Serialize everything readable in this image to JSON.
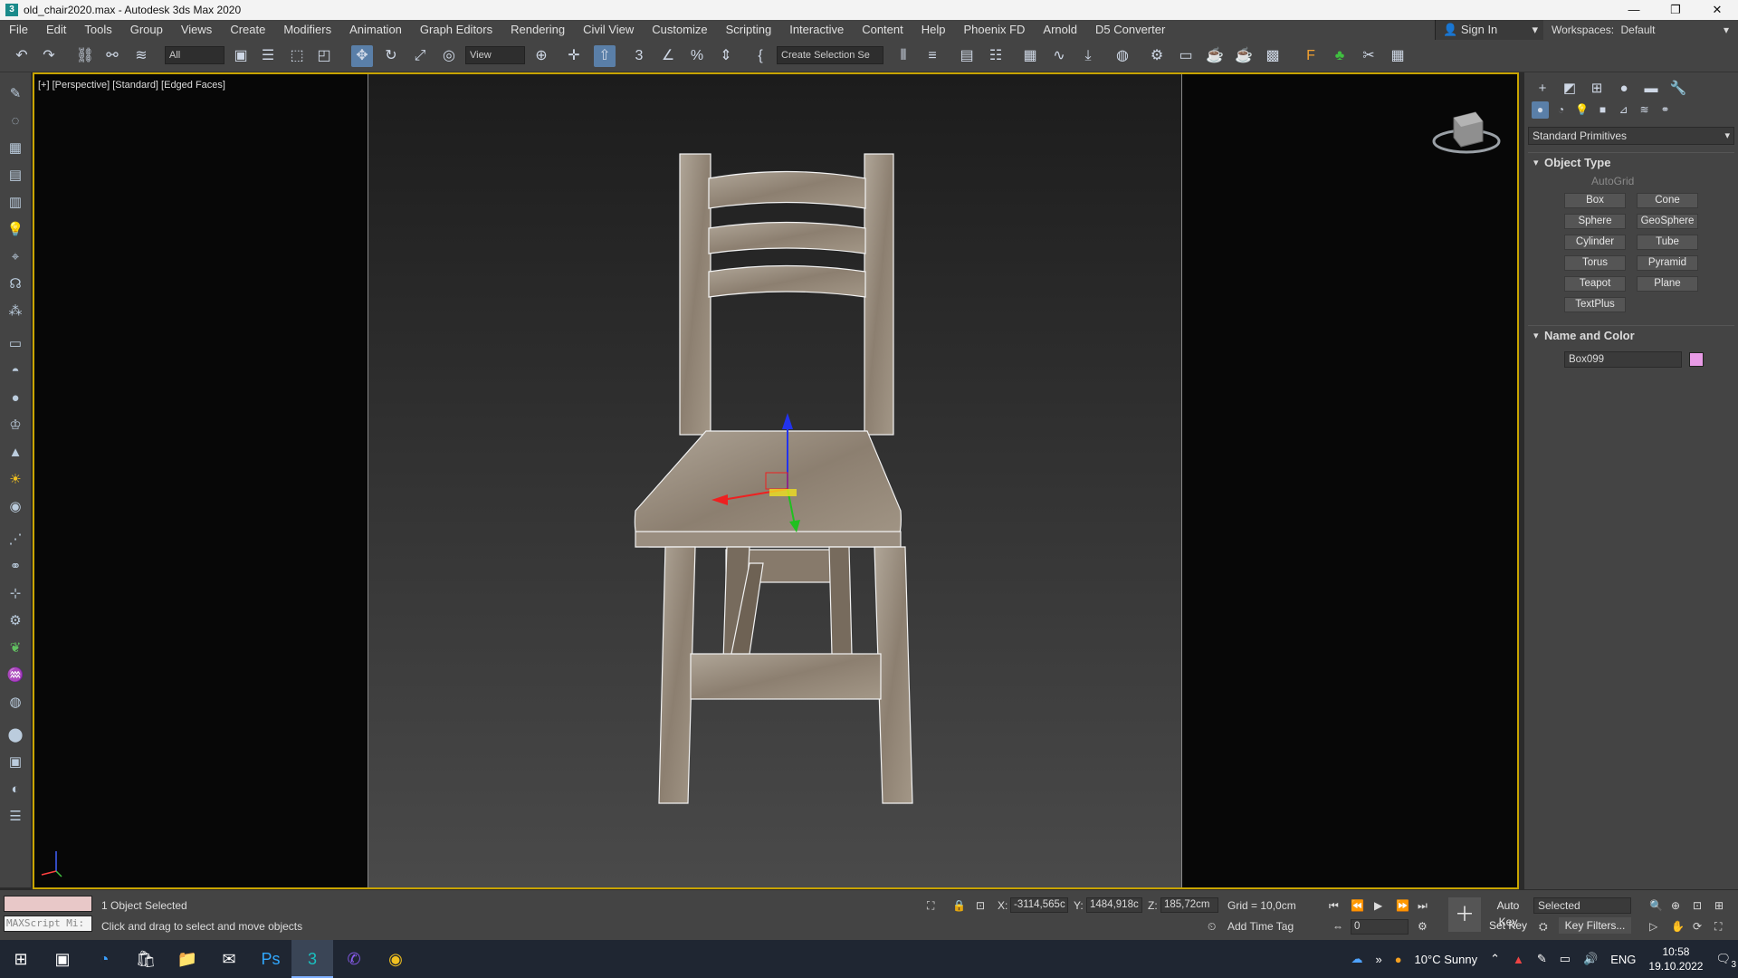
{
  "window": {
    "title": "old_chair2020.max - Autodesk 3ds Max 2020",
    "controls": [
      "—",
      "❐",
      "✕"
    ]
  },
  "menu": [
    "File",
    "Edit",
    "Tools",
    "Group",
    "Views",
    "Create",
    "Modifiers",
    "Animation",
    "Graph Editors",
    "Rendering",
    "Civil View",
    "Customize",
    "Scripting",
    "Interactive",
    "Content",
    "Help",
    "Phoenix FD",
    "Arnold",
    "D5 Converter"
  ],
  "header": {
    "sign_in": "Sign In",
    "workspaces_label": "Workspaces:",
    "workspaces_value": "Default"
  },
  "toolbar": {
    "filter_value": "All",
    "refcoord_value": "View",
    "selection_set_value": "Create Selection Se"
  },
  "viewport": {
    "label": "[+] [Perspective] [Standard] [Edged Faces]",
    "active_border_color": "#c8a400"
  },
  "command_panel": {
    "category_dropdown": "Standard Primitives",
    "object_type": {
      "title": "Object Type",
      "autogrid": "AutoGrid",
      "buttons": [
        "Box",
        "Cone",
        "Sphere",
        "GeoSphere",
        "Cylinder",
        "Tube",
        "Torus",
        "Pyramid",
        "Teapot",
        "Plane",
        "TextPlus"
      ]
    },
    "name_and_color": {
      "title": "Name and Color",
      "name": "Box099",
      "color": "#e89be6"
    }
  },
  "status": {
    "objects_selected": "1 Object Selected",
    "prompt": "Click and drag to select and move objects",
    "maxscript_placeholder": "MAXScript Mi:",
    "x_label": "X:",
    "x_value": "-3114,565c",
    "y_label": "Y:",
    "y_value": "1484,918c",
    "z_label": "Z:",
    "z_value": "185,72cm",
    "grid": "Grid = 10,0cm",
    "add_time_tag": "Add Time Tag",
    "auto_key": "Auto Key",
    "set_key": "Set Key",
    "selected_dropdown": "Selected",
    "key_filters": "Key Filters...",
    "frame_value": "0"
  },
  "taskbar": {
    "weather": "10°C  Sunny",
    "language": "ENG",
    "time": "10:58",
    "date": "19.10.2022",
    "notifications": "3"
  }
}
